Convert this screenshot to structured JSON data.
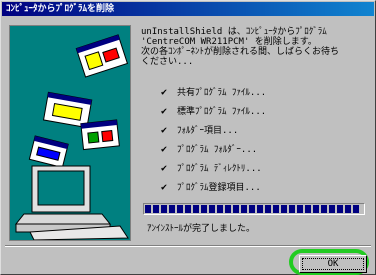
{
  "window": {
    "title": "ｺﾝﾋﾟｭｰﾀからﾌﾟﾛｸﾞﾗﾑを削除"
  },
  "message": "unInstallShield は、ｺﾝﾋﾟｭｰﾀからﾌﾟﾛｸﾞﾗﾑ\n'CentreCOM WR211PCM' を削除します。\n次の各ｺﾝﾎﾟｰﾈﾝﾄが削除される間、しばらくお待ち\nください...",
  "items": [
    {
      "label": "共有ﾌﾟﾛｸﾞﾗﾑ ﾌｧｲﾙ..."
    },
    {
      "label": "標準ﾌﾟﾛｸﾞﾗﾑ ﾌｧｲﾙ..."
    },
    {
      "label": "ﾌｫﾙﾀﾞｰ項目..."
    },
    {
      "label": "ﾌﾟﾛｸﾞﾗﾑ ﾌｫﾙﾀﾞｰ..."
    },
    {
      "label": "ﾌﾟﾛｸﾞﾗﾑ ﾃﾞｨﾚｸﾄﾘ..."
    },
    {
      "label": "ﾌﾟﾛｸﾞﾗﾑ登録項目..."
    }
  ],
  "progress": {
    "fraction": 1.0
  },
  "status": "ｱﾝｲﾝｽﾄｰﾙが完了しました。",
  "ok_label": "OK",
  "colors": {
    "title_bar": "#000080",
    "progress": "#000080",
    "panel": "#008080",
    "highlight": "#22cc22"
  },
  "icons": {
    "check": "checkmark-icon"
  }
}
